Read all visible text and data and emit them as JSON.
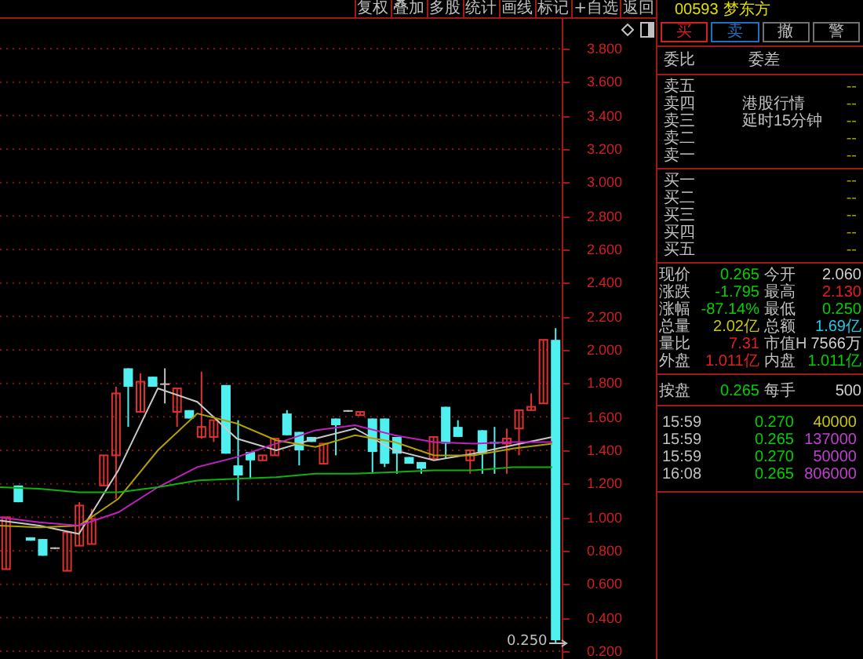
{
  "toolbar": [
    "复权",
    "叠加",
    "多股",
    "统计",
    "画线",
    "标记",
    "+自选",
    "返回"
  ],
  "chart": {
    "chart_data": {
      "type": "candlestick",
      "grid": true,
      "ylim": [
        0.2,
        3.8
      ],
      "yticks": [
        {
          "value": 3.8,
          "label": "3.800"
        },
        {
          "value": 3.6,
          "label": "3.600"
        },
        {
          "value": 3.4,
          "label": "3.400"
        },
        {
          "value": 3.2,
          "label": "3.200"
        },
        {
          "value": 3.0,
          "label": "3.000"
        },
        {
          "value": 2.8,
          "label": "2.800"
        },
        {
          "value": 2.6,
          "label": "2.600"
        },
        {
          "value": 2.4,
          "label": "2.400"
        },
        {
          "value": 2.2,
          "label": "2.200"
        },
        {
          "value": 2.0,
          "label": "2.000"
        },
        {
          "value": 1.8,
          "label": "1.800"
        },
        {
          "value": 1.6,
          "label": "1.600"
        },
        {
          "value": 1.4,
          "label": "1.400"
        },
        {
          "value": 1.2,
          "label": "1.200"
        },
        {
          "value": 1.0,
          "label": "1.000"
        },
        {
          "value": 0.8,
          "label": "0.800"
        },
        {
          "value": 0.6,
          "label": "0.600"
        },
        {
          "value": 0.4,
          "label": "0.400"
        },
        {
          "value": 0.2,
          "label": "0.200"
        }
      ],
      "ohlc": [
        [
          0.69,
          1.0,
          0.69,
          1.0
        ],
        [
          1.19,
          1.19,
          1.09,
          1.09
        ],
        [
          0.88,
          0.88,
          0.86,
          0.86
        ],
        [
          0.87,
          0.87,
          0.77,
          0.77
        ],
        [
          0.82,
          0.82,
          0.81,
          0.82
        ],
        [
          0.68,
          0.91,
          0.68,
          0.91
        ],
        [
          0.83,
          1.09,
          0.83,
          1.07
        ],
        [
          0.84,
          1.05,
          0.84,
          0.99
        ],
        [
          1.19,
          1.37,
          1.19,
          1.37
        ],
        [
          1.37,
          1.78,
          1.11,
          1.74
        ],
        [
          1.89,
          1.89,
          1.54,
          1.78
        ],
        [
          1.63,
          1.86,
          1.63,
          1.81
        ],
        [
          1.84,
          1.84,
          1.78,
          1.78
        ],
        [
          1.8,
          1.89,
          1.68,
          1.8
        ],
        [
          1.63,
          1.77,
          1.54,
          1.77
        ],
        [
          1.64,
          1.64,
          1.59,
          1.59
        ],
        [
          1.48,
          1.87,
          1.47,
          1.54
        ],
        [
          1.48,
          1.58,
          1.45,
          1.58
        ],
        [
          1.79,
          1.79,
          1.38,
          1.38
        ],
        [
          1.31,
          1.58,
          1.1,
          1.25
        ],
        [
          1.39,
          1.39,
          1.23,
          1.34
        ],
        [
          1.34,
          1.37,
          1.34,
          1.37
        ],
        [
          1.37,
          1.47,
          1.37,
          1.47
        ],
        [
          1.62,
          1.64,
          1.49,
          1.49
        ],
        [
          1.51,
          1.51,
          1.31,
          1.4
        ],
        [
          1.48,
          1.48,
          1.45,
          1.45
        ],
        [
          1.32,
          1.44,
          1.32,
          1.44
        ],
        [
          1.59,
          1.59,
          1.37,
          1.55
        ],
        [
          1.64,
          1.64,
          1.63,
          1.64
        ],
        [
          1.61,
          1.63,
          1.61,
          1.63
        ],
        [
          1.59,
          1.59,
          1.26,
          1.39
        ],
        [
          1.59,
          1.59,
          1.3,
          1.32
        ],
        [
          1.48,
          1.48,
          1.26,
          1.38
        ],
        [
          1.36,
          1.36,
          1.32,
          1.32
        ],
        [
          1.33,
          1.33,
          1.26,
          1.29
        ],
        [
          1.35,
          1.48,
          1.35,
          1.48
        ],
        [
          1.66,
          1.66,
          1.35,
          1.44
        ],
        [
          1.54,
          1.58,
          1.48,
          1.48
        ],
        [
          1.34,
          1.4,
          1.26,
          1.4
        ],
        [
          1.52,
          1.52,
          1.26,
          1.38
        ],
        [
          1.45,
          1.54,
          1.26,
          1.44
        ],
        [
          1.44,
          1.53,
          1.26,
          1.47
        ],
        [
          1.53,
          1.64,
          1.37,
          1.64
        ],
        [
          1.64,
          1.74,
          1.64,
          1.66
        ],
        [
          1.68,
          2.06,
          1.68,
          2.06
        ],
        [
          2.06,
          2.13,
          0.25,
          0.265
        ]
      ]
    },
    "averages": {
      "chart_data": {
        "type": "line",
        "ylim": [
          0.2,
          3.8
        ],
        "series": [
          {
            "color": "#c8c8c8",
            "values": [
              0.98,
              0.95,
              0.9,
              1.28,
              1.77,
              1.69,
              1.47,
              1.4,
              1.47,
              1.53,
              1.4,
              1.34,
              1.38,
              1.43,
              1.48
            ]
          },
          {
            "color": "#b0a000",
            "values": [
              0.95,
              0.94,
              0.95,
              1.11,
              1.4,
              1.62,
              1.56,
              1.46,
              1.42,
              1.49,
              1.45,
              1.37,
              1.37,
              1.41,
              1.44
            ]
          },
          {
            "color": "#c020c0",
            "values": [
              1.0,
              0.97,
              0.95,
              1.03,
              1.18,
              1.3,
              1.36,
              1.44,
              1.52,
              1.55,
              1.49,
              1.45,
              1.44,
              1.45,
              1.45
            ]
          },
          {
            "color": "#10b010",
            "values": [
              1.18,
              1.17,
              1.15,
              1.15,
              1.18,
              1.22,
              1.23,
              1.24,
              1.26,
              1.26,
              1.27,
              1.28,
              1.28,
              1.3,
              1.3
            ]
          }
        ]
      }
    },
    "low_marker": "0.250"
  },
  "stock": {
    "code": "00593",
    "name": "梦东方"
  },
  "trade_buttons": [
    {
      "label": "买",
      "color": "#d02020"
    },
    {
      "label": "卖",
      "color": "#2070c0"
    },
    {
      "label": "撤",
      "color": "#707070"
    },
    {
      "label": "警",
      "color": "#707070"
    }
  ],
  "order_header": [
    "委比",
    "委差"
  ],
  "sell_levels": [
    {
      "label": "卖五",
      "value": "--"
    },
    {
      "label": "卖四",
      "note": "港股行情",
      "value": "--"
    },
    {
      "label": "卖三",
      "note": "延时15分钟",
      "value": "--"
    },
    {
      "label": "卖二",
      "value": "--"
    },
    {
      "label": "卖一",
      "value": "--"
    }
  ],
  "buy_levels": [
    {
      "label": "买一",
      "value": "--"
    },
    {
      "label": "买二",
      "value": "--"
    },
    {
      "label": "买三",
      "value": "--"
    },
    {
      "label": "买四",
      "value": "--"
    },
    {
      "label": "买五",
      "value": "--"
    }
  ],
  "quote": [
    {
      "cells": [
        {
          "label": "现价",
          "value": "0.265",
          "color": "#00d000"
        },
        {
          "label": "今开",
          "value": "2.060",
          "color": "#d0d0d0"
        }
      ]
    },
    {
      "cells": [
        {
          "label": "涨跌",
          "value": "-1.795",
          "color": "#00d000"
        },
        {
          "label": "最高",
          "value": "2.130",
          "color": "#e02020"
        }
      ]
    },
    {
      "cells": [
        {
          "label": "涨幅",
          "value": "-87.14%",
          "color": "#00d000"
        },
        {
          "label": "最低",
          "value": "0.250",
          "color": "#00d000"
        }
      ]
    },
    {
      "cells": [
        {
          "label": "总量",
          "value": "2.02亿",
          "color": "#c8c800"
        },
        {
          "label": "总额",
          "value": "1.69亿",
          "color": "#20c8e8"
        }
      ]
    },
    {
      "cells": [
        {
          "label": "量比",
          "value": "7.31",
          "color": "#e02020"
        },
        {
          "label": "市值H",
          "value": "7566万",
          "color": "#d0d0d0"
        }
      ]
    },
    {
      "cells": [
        {
          "label": "外盘",
          "value": "1.011亿",
          "color": "#e02020"
        },
        {
          "label": "内盘",
          "value": "1.011亿",
          "color": "#00d000"
        }
      ]
    }
  ],
  "closing": {
    "cells": [
      {
        "label": "按盘",
        "value": "0.265",
        "color": "#00d000"
      },
      {
        "label": "每手",
        "value": "500",
        "color": "#d0d0d0"
      }
    ]
  },
  "trades": [
    {
      "time": "15:59",
      "price": "0.270",
      "volume": "40000",
      "color": "#c8c800"
    },
    {
      "time": "15:59",
      "price": "0.265",
      "volume": "137000",
      "color": "#c040d0"
    },
    {
      "time": "15:59",
      "price": "0.270",
      "volume": "50000",
      "color": "#c040d0"
    },
    {
      "time": "16:08",
      "price": "0.265",
      "volume": "806000",
      "color": "#c040d0"
    }
  ]
}
